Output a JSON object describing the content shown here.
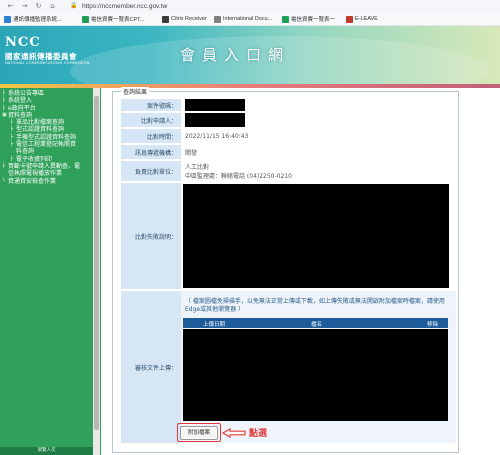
{
  "browser": {
    "url": "https://nccmember.ncc.gov.tw",
    "bookmarks": [
      {
        "label": "通訊傳播監理系統...",
        "color": "#2f7fd6"
      },
      {
        "label": "電信資費一覽表CPT...",
        "color": "#1f9e57"
      },
      {
        "label": "Citrix Receiver",
        "color": "#3a3a3a"
      },
      {
        "label": "International Docu...",
        "color": "#7f7f7f"
      },
      {
        "label": "電信資費一覽表一",
        "color": "#1f9e57"
      },
      {
        "label": "E-LEAVE",
        "color": "#c0392b"
      }
    ]
  },
  "banner": {
    "logo_abbr": "NCC",
    "logo_cn": "國家通訊傳播委員會",
    "logo_en": "NATIONAL COMMUNICATIONS COMMISSION",
    "title": "會員入口網"
  },
  "sidebar": {
    "items": [
      {
        "label": "系統公告專區",
        "sub": false
      },
      {
        "label": "系統登入",
        "sub": false
      },
      {
        "label": "e政府平台",
        "sub": false
      },
      {
        "label": "資料查詢",
        "sub": false,
        "open": true
      },
      {
        "label": "單品比對檔案查詢",
        "sub": true
      },
      {
        "label": "型式認證資料查詢",
        "sub": true
      },
      {
        "label": "手機型式認證資料查詢",
        "sub": true
      },
      {
        "label": "電信工程業登記執照資",
        "sub": true
      },
      {
        "label": "料查詢",
        "sub": true,
        "cont": true
      },
      {
        "label": "電子收據列印",
        "sub": true
      },
      {
        "label": "買斷卡號申請人異動查、電",
        "sub": false
      },
      {
        "label": "信執照電視播放作業",
        "sub": false,
        "cont": true
      },
      {
        "label": "資通資安檢查作業",
        "sub": false
      }
    ],
    "footer": "瀏覽人次"
  },
  "panel": {
    "legend": "查詢結果",
    "fields": {
      "case_no": "案件號碼：",
      "applicant": "比對申請人：",
      "time_label": "比對時間：",
      "time_value": "2022/11/15 16:40:43",
      "recipient_label": "訊息傳遞機構：",
      "recipient_value": "開發",
      "unit_label": "負責比對單位：",
      "unit_value_1": "人工比對",
      "unit_value_2": "中區監理處：聯絡電話 (04)2250-0210",
      "fail_reason_label": "比對失敗說明：",
      "upload_label": "審核文件上傳："
    },
    "notice": "（ 檔案圖檔免掃描手，以免無法正常上傳或下載，如上傳失敗或無法開啟附加檔案時檔案，請使用Edge或其他瀏覽器 ）",
    "file_table": {
      "col_date": "上傳日期",
      "col_name": "檔名",
      "col_delete": "移除"
    },
    "attach_button": "附加檔案",
    "annotation": "點選"
  }
}
